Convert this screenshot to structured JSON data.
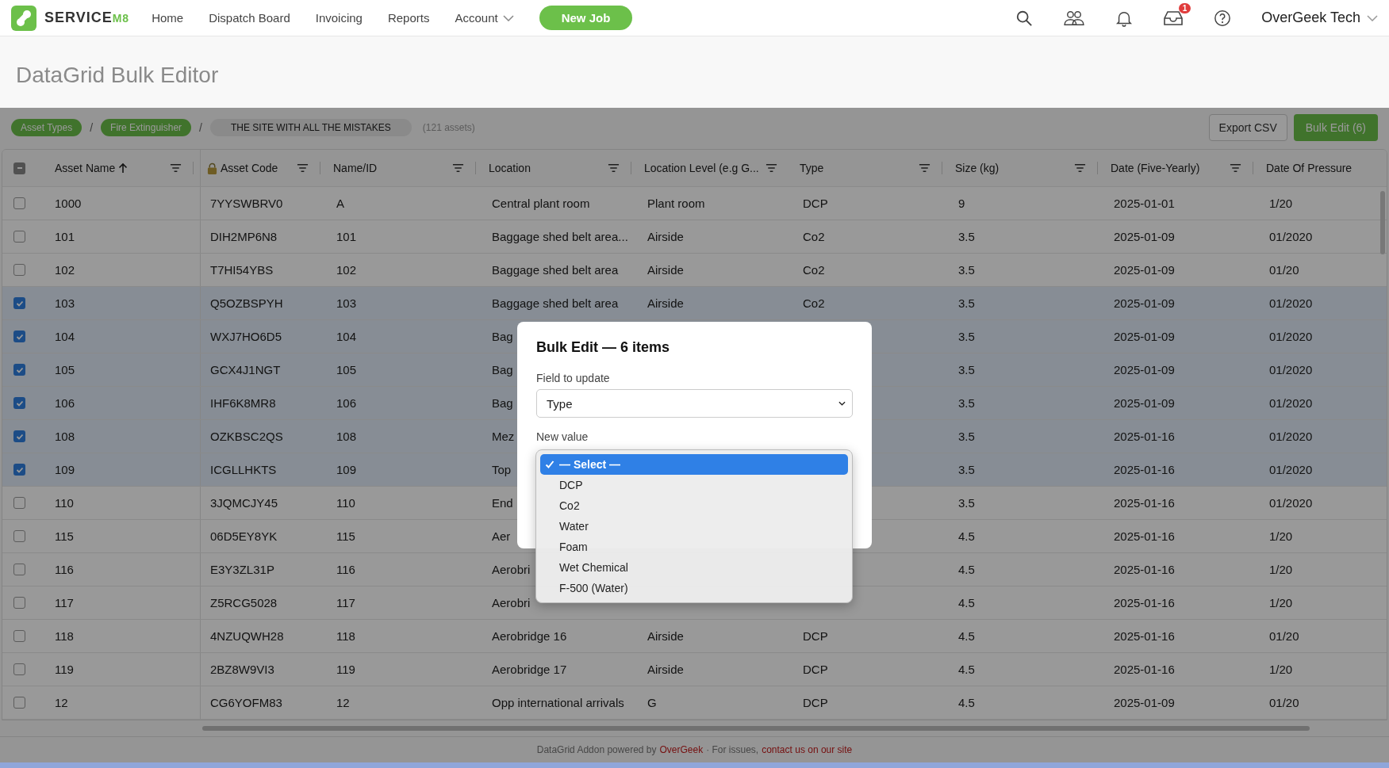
{
  "nav": {
    "brand": "SERVICE",
    "brand_suffix": "M8",
    "items": [
      {
        "label": "Home",
        "has_menu": false
      },
      {
        "label": "Dispatch Board",
        "has_menu": false
      },
      {
        "label": "Invoicing",
        "has_menu": false
      },
      {
        "label": "Reports",
        "has_menu": false
      },
      {
        "label": "Account",
        "has_menu": true
      }
    ],
    "new_job": "New Job",
    "inbox_badge": "1",
    "user": "OverGeek Tech"
  },
  "page_title": "DataGrid Bulk Editor",
  "breadcrumb": {
    "chips": [
      {
        "label": "Asset Types",
        "kind": "link"
      },
      {
        "label": "Fire Extinguisher",
        "kind": "link"
      },
      {
        "label": "THE SITE WITH ALL THE MISTAKES",
        "kind": "current"
      }
    ],
    "separator": "/",
    "count": "(121 assets)"
  },
  "actions": {
    "export": "Export CSV",
    "bulk_edit": "Bulk Edit (6)"
  },
  "table": {
    "select_all_indeterminate": true,
    "columns": [
      {
        "label": "Asset Name",
        "sorted": true,
        "locked": false,
        "filter": true
      },
      {
        "label": "Asset Code",
        "sorted": false,
        "locked": true,
        "filter": true
      },
      {
        "label": "Name/ID",
        "sorted": false,
        "locked": false,
        "filter": true
      },
      {
        "label": "Location",
        "sorted": false,
        "locked": false,
        "filter": true
      },
      {
        "label": "Location Level (e.g G...",
        "sorted": false,
        "locked": false,
        "filter": true
      },
      {
        "label": "Type",
        "sorted": false,
        "locked": false,
        "filter": true
      },
      {
        "label": "Size (kg)",
        "sorted": false,
        "locked": false,
        "filter": true
      },
      {
        "label": "Date (Five-Yearly)",
        "sorted": false,
        "locked": false,
        "filter": true
      },
      {
        "label": "Date Of Pressure",
        "sorted": false,
        "locked": false,
        "filter": false
      }
    ],
    "rows": [
      {
        "selected": false,
        "cells": [
          "1000",
          "7YYSWBRV0",
          "A",
          "Central plant room",
          "Plant room",
          "DCP",
          "9",
          "2025-01-01",
          "1/20"
        ]
      },
      {
        "selected": false,
        "cells": [
          "101",
          "DIH2MP6N8",
          "101",
          "Baggage shed belt area...",
          "Airside",
          "Co2",
          "3.5",
          "2025-01-09",
          "01/2020"
        ]
      },
      {
        "selected": false,
        "cells": [
          "102",
          "T7HI54YBS",
          "102",
          "Baggage shed belt area",
          "Airside",
          "Co2",
          "3.5",
          "2025-01-09",
          "01/20"
        ]
      },
      {
        "selected": true,
        "cells": [
          "103",
          "Q5OZBSPYH",
          "103",
          "Baggage shed belt area",
          "Airside",
          "Co2",
          "3.5",
          "2025-01-09",
          "01/2020"
        ]
      },
      {
        "selected": true,
        "cells": [
          "104",
          "WXJ7HO6D5",
          "104",
          "Bag",
          null,
          null,
          "3.5",
          "2025-01-09",
          "01/2020"
        ]
      },
      {
        "selected": true,
        "cells": [
          "105",
          "GCX4J1NGT",
          "105",
          "Bag",
          null,
          null,
          "3.5",
          "2025-01-09",
          "01/2020"
        ]
      },
      {
        "selected": true,
        "cells": [
          "106",
          "IHF6K8MR8",
          "106",
          "Bag",
          null,
          null,
          "3.5",
          "2025-01-09",
          "01/2020"
        ]
      },
      {
        "selected": true,
        "cells": [
          "108",
          "OZKBSC2QS",
          "108",
          "Mez",
          null,
          null,
          "3.5",
          "2025-01-16",
          "01/2020"
        ]
      },
      {
        "selected": true,
        "cells": [
          "109",
          "ICGLLHKTS",
          "109",
          "Top",
          null,
          null,
          "3.5",
          "2025-01-16",
          "01/2020"
        ]
      },
      {
        "selected": false,
        "cells": [
          "110",
          "3JQMCJY45",
          "110",
          "End",
          null,
          null,
          "3.5",
          "2025-01-16",
          "01/2020"
        ]
      },
      {
        "selected": false,
        "cells": [
          "115",
          "06D5EY8YK",
          "115",
          "Aer",
          null,
          null,
          "4.5",
          "2025-01-16",
          "1/20"
        ]
      },
      {
        "selected": false,
        "cells": [
          "116",
          "E3Y3ZL31P",
          "116",
          "Aerobri",
          null,
          null,
          "4.5",
          "2025-01-16",
          "1/20"
        ]
      },
      {
        "selected": false,
        "cells": [
          "117",
          "Z5RCG5028",
          "117",
          "Aerobri",
          null,
          null,
          "4.5",
          "2025-01-16",
          "1/20"
        ]
      },
      {
        "selected": false,
        "cells": [
          "118",
          "4NZUQWH28",
          "118",
          "Aerobridge 16",
          "Airside",
          "DCP",
          "4.5",
          "2025-01-16",
          "01/20"
        ]
      },
      {
        "selected": false,
        "cells": [
          "119",
          "2BZ8W9VI3",
          "119",
          "Aerobridge 17",
          "Airside",
          "DCP",
          "4.5",
          "2025-01-16",
          "1/20"
        ]
      },
      {
        "selected": false,
        "cells": [
          "12",
          "CG6YOFM83",
          "12",
          "Opp international arrivals",
          "G",
          "DCP",
          "4.5",
          "2025-01-09",
          "01/20"
        ]
      }
    ]
  },
  "footer": {
    "prefix": "DataGrid Addon powered by",
    "link": "OverGeek",
    "middle": "· For issues,",
    "contact": "contact us on our site"
  },
  "modal": {
    "title": "Bulk Edit — 6 items",
    "field_label": "Field to update",
    "field_value": "Type",
    "value_label": "New value",
    "options": [
      {
        "label": "— Select —",
        "selected": true
      },
      {
        "label": "DCP",
        "selected": false
      },
      {
        "label": "Co2",
        "selected": false
      },
      {
        "label": "Water",
        "selected": false
      },
      {
        "label": "Foam",
        "selected": false
      },
      {
        "label": "Wet Chemical",
        "selected": false
      },
      {
        "label": "F-500 (Water)",
        "selected": false
      }
    ]
  }
}
